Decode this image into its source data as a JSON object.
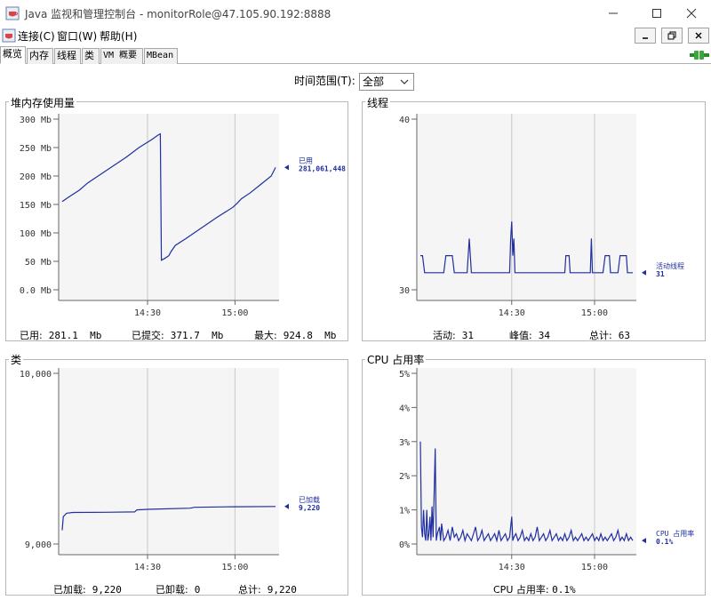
{
  "window": {
    "title": "Java 监视和管理控制台 - monitorRole@47.105.90.192:8888"
  },
  "menu": {
    "items": [
      "连接(C)",
      "窗口(W)",
      "帮助(H)"
    ]
  },
  "tabs": [
    "概览",
    "内存",
    "线程",
    "类",
    "VM 概要",
    "MBean"
  ],
  "time_range": {
    "label": "时间范围(T):",
    "value": "全部"
  },
  "colors": {
    "series": "#1f2ea0",
    "grid": "#c8c8c8",
    "plot_bg": "#f5f5f5"
  },
  "panels": {
    "heap": {
      "title": "堆内存使用量",
      "stats": [
        {
          "label": "已用:",
          "value": "281.1  Mb"
        },
        {
          "label": "已提交:",
          "value": "371.7  Mb"
        },
        {
          "label": "最大:",
          "value": "924.8  Mb"
        }
      ]
    },
    "threads": {
      "title": "线程",
      "stats": [
        {
          "label": "活动:",
          "value": "31"
        },
        {
          "label": "峰值:",
          "value": "34"
        },
        {
          "label": "总计:",
          "value": "63"
        }
      ]
    },
    "classes": {
      "title": "类",
      "stats": [
        {
          "label": "已加载:",
          "value": "9,220"
        },
        {
          "label": "已卸载:",
          "value": "0"
        },
        {
          "label": "总计:",
          "value": "9,220"
        }
      ]
    },
    "cpu": {
      "title": "CPU 占用率",
      "stats": [
        {
          "label": "CPU 占用率:",
          "value": "0.1%"
        }
      ]
    }
  },
  "chart_data": [
    {
      "type": "line",
      "id": "heap",
      "x_tick_labels": [
        "14:30",
        "15:00"
      ],
      "y_tick_labels": [
        "0.0 Mb",
        "50 Mb",
        "100 Mb",
        "150 Mb",
        "200 Mb",
        "250 Mb",
        "300 Mb"
      ],
      "ylim": [
        0,
        300
      ],
      "xlim": [
        0,
        100
      ],
      "x_ticks": [
        40,
        81
      ],
      "series": [
        {
          "name": "已用",
          "label_value": "281,061,448",
          "points": [
            [
              0,
              155
            ],
            [
              3,
              163
            ],
            [
              8,
              175
            ],
            [
              12,
              188
            ],
            [
              18,
              203
            ],
            [
              24,
              218
            ],
            [
              30,
              233
            ],
            [
              36,
              250
            ],
            [
              42,
              264
            ],
            [
              45,
              272
            ],
            [
              46,
              274
            ],
            [
              46.5,
              52
            ],
            [
              48,
              55
            ],
            [
              50,
              60
            ],
            [
              51,
              67
            ],
            [
              53,
              78
            ],
            [
              58,
              90
            ],
            [
              65,
              108
            ],
            [
              72,
              126
            ],
            [
              80,
              145
            ],
            [
              82,
              152
            ],
            [
              84,
              160
            ],
            [
              88,
              170
            ],
            [
              93,
              185
            ],
            [
              98,
              200
            ],
            [
              100,
              215
            ],
            [
              100,
              215
            ]
          ]
        }
      ]
    },
    {
      "type": "line",
      "id": "threads",
      "x_tick_labels": [
        "14:30",
        "15:00"
      ],
      "y_tick_labels": [
        "30",
        "40"
      ],
      "ylim": [
        30,
        40
      ],
      "xlim": [
        0,
        100
      ],
      "x_ticks": [
        43,
        82
      ],
      "series": [
        {
          "name": "活动线程",
          "label_value": "31",
          "points": [
            [
              0,
              32
            ],
            [
              1,
              32
            ],
            [
              2,
              31
            ],
            [
              11,
              31
            ],
            [
              12,
              32
            ],
            [
              15,
              32
            ],
            [
              16,
              31
            ],
            [
              22,
              31
            ],
            [
              23,
              33
            ],
            [
              24,
              31
            ],
            [
              42,
              31
            ],
            [
              42.5,
              33
            ],
            [
              43,
              34
            ],
            [
              43.5,
              32
            ],
            [
              44,
              33
            ],
            [
              44.5,
              31
            ],
            [
              68,
              31
            ],
            [
              68.5,
              32
            ],
            [
              70,
              32
            ],
            [
              70.5,
              31
            ],
            [
              80,
              31
            ],
            [
              80.5,
              33
            ],
            [
              81,
              31
            ],
            [
              86,
              31
            ],
            [
              87,
              32
            ],
            [
              89,
              32
            ],
            [
              89.5,
              31
            ],
            [
              93,
              31
            ],
            [
              94,
              32
            ],
            [
              97,
              32
            ],
            [
              97.5,
              31
            ],
            [
              100,
              31
            ]
          ]
        }
      ]
    },
    {
      "type": "line",
      "id": "classes",
      "x_tick_labels": [
        "14:30",
        "15:00"
      ],
      "y_tick_labels": [
        "9,000",
        "10,000"
      ],
      "ylim": [
        9000,
        10000
      ],
      "xlim": [
        0,
        100
      ],
      "x_ticks": [
        40,
        81
      ],
      "series": [
        {
          "name": "已加载",
          "label_value": "9,220",
          "points": [
            [
              0,
              9080
            ],
            [
              0.5,
              9160
            ],
            [
              2,
              9180
            ],
            [
              5,
              9185
            ],
            [
              20,
              9186
            ],
            [
              34,
              9188
            ],
            [
              35,
              9200
            ],
            [
              40,
              9203
            ],
            [
              60,
              9210
            ],
            [
              62,
              9215
            ],
            [
              80,
              9218
            ],
            [
              100,
              9220
            ]
          ]
        }
      ]
    },
    {
      "type": "line",
      "id": "cpu",
      "x_tick_labels": [
        "14:30",
        "15:00"
      ],
      "y_tick_labels": [
        "0%",
        "1%",
        "2%",
        "3%",
        "4%",
        "5%"
      ],
      "ylim": [
        0,
        5
      ],
      "xlim": [
        0,
        100
      ],
      "x_ticks": [
        43,
        82
      ],
      "series": [
        {
          "name": "CPU 占用率",
          "label_value": "0.1%",
          "points": [
            [
              0,
              3.0
            ],
            [
              0.5,
              0.5
            ],
            [
              1,
              0.2
            ],
            [
              1.5,
              1.0
            ],
            [
              2,
              0.3
            ],
            [
              2.5,
              0.1
            ],
            [
              3,
              1.0
            ],
            [
              3.5,
              0.1
            ],
            [
              4,
              0.3
            ],
            [
              4.5,
              0.8
            ],
            [
              5,
              0.1
            ],
            [
              5.5,
              1.1
            ],
            [
              6,
              0.2
            ],
            [
              7,
              2.8
            ],
            [
              7.5,
              0.1
            ],
            [
              8,
              0.3
            ],
            [
              9,
              0.5
            ],
            [
              9.5,
              0.1
            ],
            [
              10,
              0.6
            ],
            [
              11,
              0.1
            ],
            [
              12,
              0.2
            ],
            [
              13,
              0.4
            ],
            [
              14,
              0.1
            ],
            [
              15,
              0.5
            ],
            [
              16,
              0.2
            ],
            [
              17,
              0.3
            ],
            [
              18,
              0.1
            ],
            [
              19,
              0.2
            ],
            [
              20,
              0.4
            ],
            [
              21,
              0.1
            ],
            [
              22,
              0.3
            ],
            [
              23,
              0.2
            ],
            [
              24,
              0.1
            ],
            [
              25,
              0.3
            ],
            [
              26,
              0.5
            ],
            [
              27,
              0.1
            ],
            [
              28,
              0.2
            ],
            [
              29,
              0.4
            ],
            [
              30,
              0.1
            ],
            [
              31,
              0.2
            ],
            [
              32,
              0.3
            ],
            [
              33,
              0.1
            ],
            [
              34,
              0.2
            ],
            [
              35,
              0.3
            ],
            [
              36,
              0.1
            ],
            [
              37,
              0.4
            ],
            [
              38,
              0.1
            ],
            [
              39,
              0.2
            ],
            [
              40,
              0.3
            ],
            [
              41,
              0.1
            ],
            [
              42,
              0.2
            ],
            [
              43,
              0.8
            ],
            [
              43.5,
              0.1
            ],
            [
              44,
              0.2
            ],
            [
              45,
              0.3
            ],
            [
              46,
              0.1
            ],
            [
              47,
              0.2
            ],
            [
              48,
              0.4
            ],
            [
              49,
              0.1
            ],
            [
              50,
              0.2
            ],
            [
              51,
              0.1
            ],
            [
              52,
              0.3
            ],
            [
              53,
              0.1
            ],
            [
              54,
              0.2
            ],
            [
              55,
              0.5
            ],
            [
              56,
              0.1
            ],
            [
              57,
              0.2
            ],
            [
              58,
              0.3
            ],
            [
              59,
              0.1
            ],
            [
              60,
              0.2
            ],
            [
              61,
              0.4
            ],
            [
              62,
              0.1
            ],
            [
              63,
              0.2
            ],
            [
              64,
              0.3
            ],
            [
              65,
              0.1
            ],
            [
              66,
              0.2
            ],
            [
              67,
              0.1
            ],
            [
              68,
              0.3
            ],
            [
              69,
              0.1
            ],
            [
              70,
              0.2
            ],
            [
              71,
              0.4
            ],
            [
              72,
              0.1
            ],
            [
              73,
              0.2
            ],
            [
              74,
              0.1
            ],
            [
              75,
              0.2
            ],
            [
              76,
              0.3
            ],
            [
              77,
              0.1
            ],
            [
              78,
              0.2
            ],
            [
              79,
              0.1
            ],
            [
              80,
              0.2
            ],
            [
              81,
              0.3
            ],
            [
              82,
              0.1
            ],
            [
              83,
              0.2
            ],
            [
              84,
              0.1
            ],
            [
              85,
              0.3
            ],
            [
              86,
              0.1
            ],
            [
              87,
              0.2
            ],
            [
              88,
              0.1
            ],
            [
              89,
              0.2
            ],
            [
              90,
              0.3
            ],
            [
              91,
              0.1
            ],
            [
              92,
              0.2
            ],
            [
              93,
              0.4
            ],
            [
              94,
              0.1
            ],
            [
              95,
              0.2
            ],
            [
              96,
              0.1
            ],
            [
              97,
              0.3
            ],
            [
              98,
              0.1
            ],
            [
              99,
              0.2
            ],
            [
              100,
              0.1
            ]
          ]
        }
      ]
    }
  ]
}
